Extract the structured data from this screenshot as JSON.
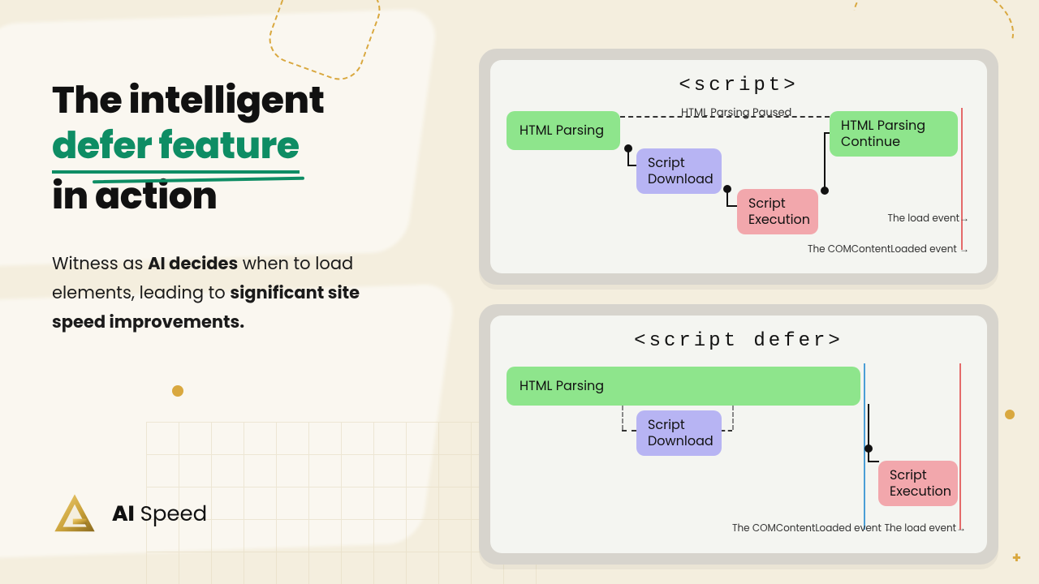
{
  "headline": {
    "line1": "The intelligent",
    "highlight": "defer feature",
    "line3": "in action"
  },
  "subtext": {
    "pre": "Witness as ",
    "bold1": "AI decides",
    "mid": " when to load elements, leading to ",
    "bold2": "significant site speed improvements."
  },
  "logo": {
    "bold": "AI",
    "rest": " Speed"
  },
  "card1": {
    "title": "<script>",
    "blocks": {
      "html_parsing": "HTML Parsing",
      "paused_note": "HTML Parsing Paused",
      "script_download": "Script\nDownload",
      "script_execution": "Script\nExecution",
      "html_continue": "HTML Parsing\nContinue"
    },
    "captions": {
      "load_event": "The load event→",
      "dom_event": "The COMContentLoaded event  →"
    }
  },
  "card2": {
    "title": "<script defer>",
    "blocks": {
      "html_parsing": "HTML Parsing",
      "script_download": "Script\nDownload",
      "script_execution": "Script\nExecution"
    },
    "captions": {
      "dom_event": "The COMContentLoaded event  →",
      "load_event": "The load event→"
    }
  }
}
